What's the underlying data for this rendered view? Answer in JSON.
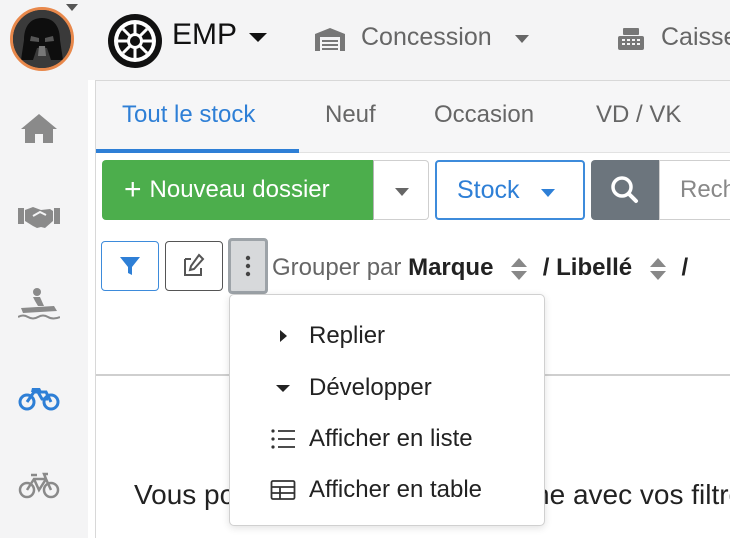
{
  "topbar": {
    "brand_name": "EMP",
    "store_label": "Concession",
    "register_label": "Caisse"
  },
  "tabs": [
    {
      "label": "Tout le stock",
      "active": true
    },
    {
      "label": "Neuf",
      "active": false
    },
    {
      "label": "Occasion",
      "active": false
    },
    {
      "label": "VD / VK",
      "active": false
    }
  ],
  "toolbar": {
    "new_file_label": "Nouveau dossier",
    "stock_label": "Stock",
    "search_placeholder": "Recherche"
  },
  "grouping": {
    "prefix": "Grouper par",
    "fields": [
      "Marque",
      "Libellé"
    ],
    "separator": "/"
  },
  "menu": {
    "items": [
      {
        "label": "Replier",
        "icon": "caret-right-icon"
      },
      {
        "label": "Développer",
        "icon": "caret-down-icon"
      },
      {
        "label": "Afficher en liste",
        "icon": "list-icon"
      },
      {
        "label": "Afficher en table",
        "icon": "table-icon"
      }
    ]
  },
  "empty_message": "Vous pouvez lancer une recherche avec vos filtres",
  "colors": {
    "accent": "#2e7fd6",
    "success": "#4cae4c",
    "secondary": "#6c757d",
    "avatar_border": "#e8884b"
  }
}
